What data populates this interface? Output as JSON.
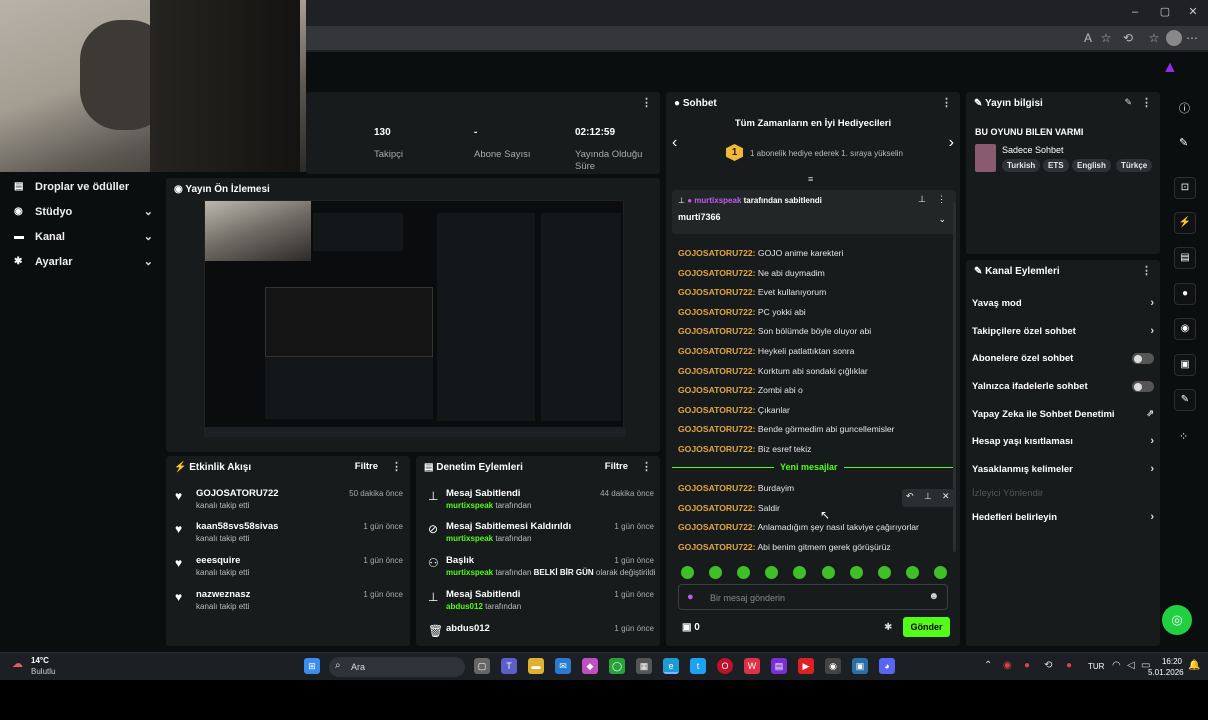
{
  "browser": {
    "controls": {
      "min": "‒",
      "max": "▢",
      "close": "✕"
    }
  },
  "nav": {
    "items": [
      {
        "label": "Droplar ve ödüller",
        "icon": "gift-icon"
      },
      {
        "label": "Stüdyo",
        "icon": "studio-icon"
      },
      {
        "label": "Kanal",
        "icon": "channel-icon"
      },
      {
        "label": "Ayarlar",
        "icon": "gear-icon"
      }
    ]
  },
  "stats": [
    {
      "value": "130",
      "label": "Takipçi"
    },
    {
      "value": "-",
      "label": "Abone Sayısı"
    },
    {
      "value": "02:12:59",
      "label": "Yayında Olduğu Süre"
    }
  ],
  "preview": {
    "title": "Yayın Ön İzlemesi"
  },
  "activity": {
    "title": "Etkinlik Akışı",
    "filter": "Filtre",
    "items": [
      {
        "name": "GOJOSATORU722",
        "sub": "kanalı takip etti",
        "time": "50 dakika önce"
      },
      {
        "name": "kaan58svs58sivas",
        "sub": "kanalı takip etti",
        "time": "1 gün önce"
      },
      {
        "name": "eeesquire",
        "sub": "kanalı takip etti",
        "time": "1 gün önce"
      },
      {
        "name": "nazweznasz",
        "sub": "kanalı takip etti",
        "time": "1 gün önce"
      }
    ]
  },
  "moderation": {
    "title": "Denetim Eylemleri",
    "filter": "Filtre",
    "items": [
      {
        "name": "Mesaj Sabitlendi",
        "user": "murtixspeak",
        "suffix": "tarafından",
        "time": "44 dakika önce",
        "icon": "pin-icon"
      },
      {
        "name": "Mesaj Sabitlemesi Kaldırıldı",
        "user": "murtixspeak",
        "suffix": "tarafından",
        "time": "1 gün önce",
        "icon": "unpin-icon"
      },
      {
        "name": "Başlık",
        "user": "murtixspeak",
        "suffix": "tarafından",
        "bold": "BELKİ BİR GÜN",
        "suffix2": "olarak değiştirildi",
        "time": "1 gün önce",
        "icon": "people-icon"
      },
      {
        "name": "Mesaj Sabitlendi",
        "user": "abdus012",
        "suffix": "tarafından",
        "time": "1 gün önce",
        "icon": "pin-icon"
      },
      {
        "name": "abdus012",
        "user": "",
        "suffix": "",
        "time": "1 gün önce",
        "icon": "trash-icon"
      }
    ]
  },
  "chat": {
    "title": "Sohbet",
    "top_gifters_title": "Tüm Zamanların en İyi Hediyecileri",
    "gifter_rank": "1",
    "gifter_text": "1 abonelik hediye ederek 1. sıraya yükselin",
    "pinned_by_user": "murtixspeak",
    "pinned_by_suffix": "tarafından sabitlendi",
    "pinned_text": "murti7366",
    "new_messages": "Yeni mesajlar",
    "input_placeholder": "Bir mesaj gönderin",
    "points": "0",
    "send": "Gönder",
    "messages": [
      {
        "u": "GOJOSATORU722:",
        "t": "GOJO anime karekteri"
      },
      {
        "u": "GOJOSATORU722:",
        "t": "Ne abi duymadim"
      },
      {
        "u": "GOJOSATORU722:",
        "t": "Evet kullanıyorum"
      },
      {
        "u": "GOJOSATORU722:",
        "t": "PC yokki abi"
      },
      {
        "u": "GOJOSATORU722:",
        "t": "Son bölümde böyle oluyor abi"
      },
      {
        "u": "GOJOSATORU722:",
        "t": "Heykeli patlattıktan sonra"
      },
      {
        "u": "GOJOSATORU722:",
        "t": "Korktum abi sondaki çığlıklar"
      },
      {
        "u": "GOJOSATORU722:",
        "t": "Zombi abi o"
      },
      {
        "u": "GOJOSATORU722:",
        "t": "Çıkanlar"
      },
      {
        "u": "GOJOSATORU722:",
        "t": "Bende görmedim abi guncellemisler"
      },
      {
        "u": "GOJOSATORU722:",
        "t": "Biz esref tekiz"
      }
    ],
    "new_msgs": [
      {
        "u": "GOJOSATORU722:",
        "t": "Burdayim"
      },
      {
        "u": "GOJOSATORU722:",
        "t": "Saldir"
      },
      {
        "u": "GOJOSATORU722:",
        "t": "Anlamadığım şey nasıl takviye çağırıyorlar"
      },
      {
        "u": "GOJOSATORU722:",
        "t": "Abi benim gitmem gerek görüşürüz"
      }
    ]
  },
  "stream_info": {
    "title": "Yayın bilgisi",
    "stream_title": "BU OYUNU BILEN VARMI",
    "category": "Sadece Sohbet",
    "tags": [
      "Turkish",
      "ETS",
      "English",
      "Türkçe"
    ]
  },
  "channel_actions": {
    "title": "Kanal Eylemleri",
    "items": [
      {
        "label": "Yavaş mod",
        "type": "arrow"
      },
      {
        "label": "Takipçilere özel sohbet",
        "type": "arrow"
      },
      {
        "label": "Abonelere özel sohbet",
        "type": "toggle"
      },
      {
        "label": "Yalnızca ifadelerle sohbet",
        "type": "toggle"
      },
      {
        "label": "Yapay Zeka ile Sohbet Denetimi",
        "type": "external"
      },
      {
        "label": "Hesap yaşı kısıtlaması",
        "type": "arrow"
      },
      {
        "label": "Yasaklanmış kelimeler",
        "type": "arrow"
      },
      {
        "label": "İzleyici Yönlendir",
        "type": "disabled"
      },
      {
        "label": "Hedefleri belirleyin",
        "type": "arrow"
      }
    ]
  },
  "taskbar": {
    "weather_temp": "14°C",
    "weather_desc": "Bulutlu",
    "search": "Ara",
    "lang": "TUR",
    "time": "16:20",
    "date": "5.01.2026"
  }
}
